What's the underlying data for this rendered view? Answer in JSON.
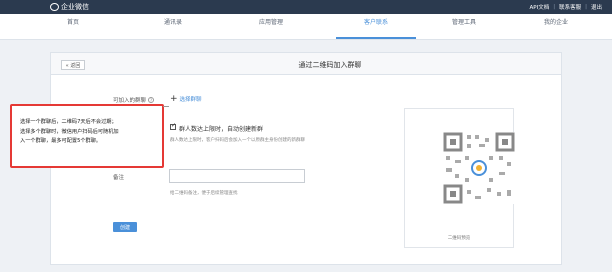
{
  "topbar": {
    "app_name": "企业微信",
    "links": [
      "API文档",
      "联系客服",
      "退出"
    ]
  },
  "nav": {
    "items": [
      "首页",
      "通讯录",
      "应用管理",
      "客户联系",
      "管理工具",
      "我的企业"
    ],
    "active_index": 3
  },
  "panel": {
    "back_label": "« 返回",
    "title": "通过二维码加入群聊"
  },
  "form": {
    "group_label": "可加入的群聊",
    "add_group_label": "选择群聊",
    "auto_create_label": "群人数达上限时，自动创建新群",
    "auto_create_desc": "群人数达上限时，客户扫码后会加入一个以原群主身份创建的新群聊",
    "remark_label": "备注",
    "remark_value": "",
    "remark_hint": "给二维码备注，便于后续管理查找",
    "create_label": "创建"
  },
  "qr": {
    "caption": "二维码预览"
  },
  "tooltip": {
    "line1": "选择一个群聊后，二维码7天后不会过期；",
    "line2": "选择多个群聊时，微信用户扫码后可随机加",
    "line3": "入一个群聊，最多可配置5个群聊。"
  },
  "colors": {
    "topbar": "#2b3a4f",
    "accent": "#4a90d9",
    "highlight": "#e53935"
  }
}
